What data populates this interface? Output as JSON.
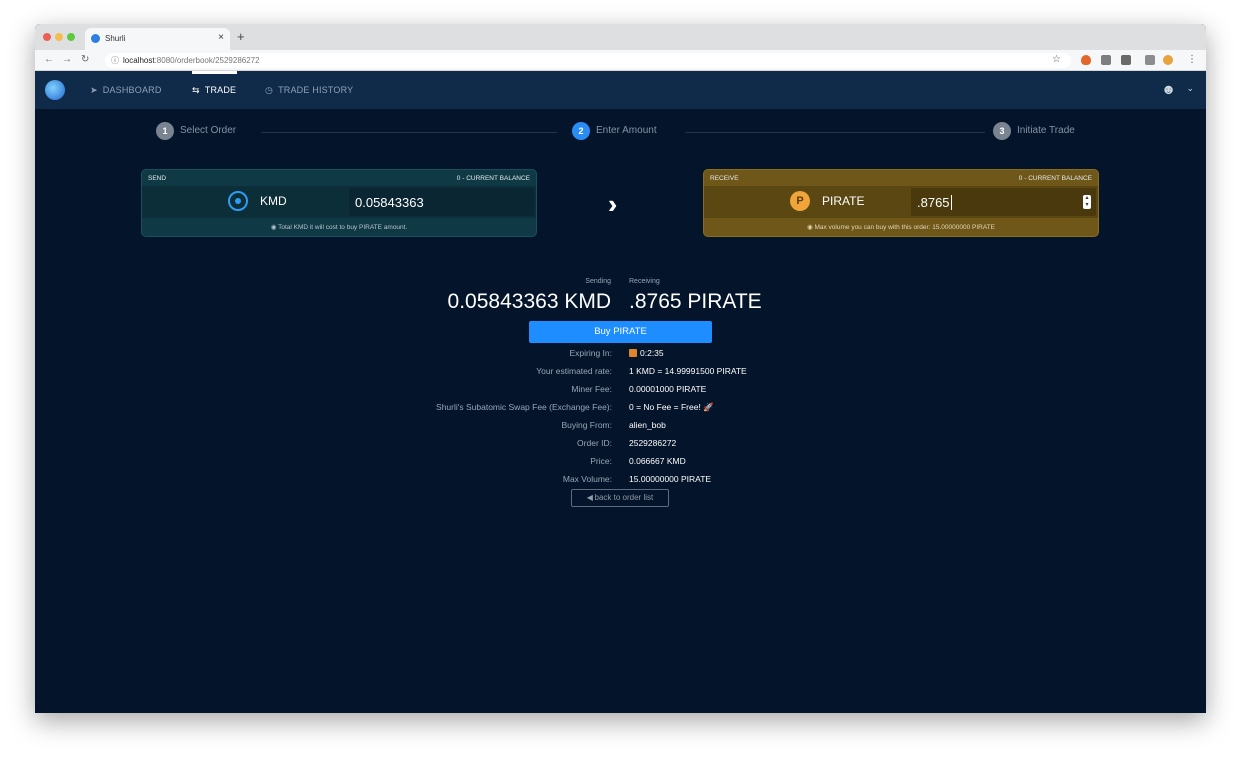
{
  "browser": {
    "tab_title": "Shurli",
    "tab_close": "×",
    "new_tab": "+",
    "url_host": "localhost",
    "url_path": ":8080/orderbook/2529286272"
  },
  "nav": {
    "items": [
      {
        "label": "DASHBOARD",
        "icon": "rocket-icon"
      },
      {
        "label": "TRADE",
        "icon": "swap-icon"
      },
      {
        "label": "TRADE HISTORY",
        "icon": "history-icon"
      }
    ]
  },
  "steps": [
    {
      "num": "1",
      "label": "Select Order"
    },
    {
      "num": "2",
      "label": "Enter Amount"
    },
    {
      "num": "3",
      "label": "Initiate Trade"
    }
  ],
  "send": {
    "header": "SEND",
    "balance": "0 - CURRENT BALANCE",
    "coin": "KMD",
    "amount": "0.05843363",
    "note": "Total KMD it will cost to buy PIRATE amount."
  },
  "receive": {
    "header": "RECEIVE",
    "balance": "0 - CURRENT BALANCE",
    "coin": "PIRATE",
    "coin_glyph": "P",
    "amount": ".8765",
    "note": "Max volume you can buy with this order: 15.00000000 PIRATE"
  },
  "summary": {
    "sending_caption": "Sending",
    "receiving_caption": "Receiving",
    "sending_amount": "0.05843363 KMD",
    "receiving_amount": ".8765 PIRATE",
    "buy_label": "Buy PIRATE"
  },
  "details": [
    {
      "key": "Expiring In:",
      "value": "0:2:35"
    },
    {
      "key": "Your estimated rate:",
      "value": "1 KMD = 14.99991500 PIRATE"
    },
    {
      "key": "Miner Fee:",
      "value": "0.00001000 PIRATE"
    },
    {
      "key": "Shurli's Subatomic Swap Fee (Exchange Fee):",
      "value": "0 = No Fee = Free! 🚀"
    },
    {
      "key": "Buying From:",
      "value": "alien_bob"
    },
    {
      "key": "Order ID:",
      "value": "2529286272"
    },
    {
      "key": "Price:",
      "value": "0.066667 KMD"
    },
    {
      "key": "Max Volume:",
      "value": "15.00000000 PIRATE"
    }
  ],
  "back_label": "back to order list",
  "colors": {
    "accent": "#1e8dff",
    "send_panel": "#0f3a45",
    "receive_panel": "#6e5718",
    "background": "#03142b"
  }
}
